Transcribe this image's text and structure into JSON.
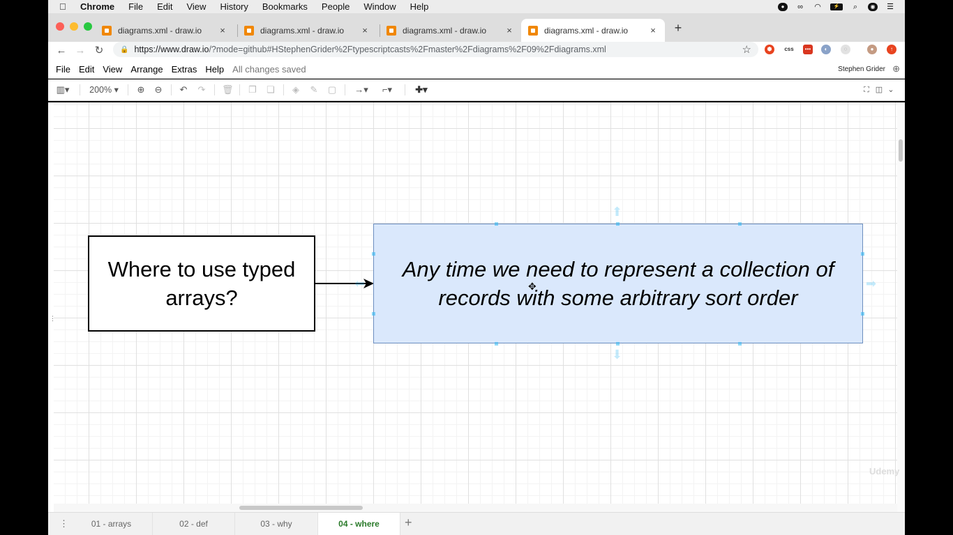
{
  "menubar": {
    "app": "Chrome",
    "items": [
      "File",
      "Edit",
      "View",
      "History",
      "Bookmarks",
      "People",
      "Window",
      "Help"
    ]
  },
  "tabs": [
    {
      "title": "diagrams.xml - draw.io",
      "close": "×"
    },
    {
      "title": "diagrams.xml - draw.io",
      "close": "×"
    },
    {
      "title": "diagrams.xml - draw.io",
      "close": "×"
    },
    {
      "title": "diagrams.xml - draw.io",
      "close": "×"
    }
  ],
  "new_tab": "+",
  "address": {
    "host": "https://www.draw.io",
    "rest": "/?mode=github#HStephenGrider%2Ftypescriptcasts%2Fmaster%2Fdiagrams%2F09%2Fdiagrams.xml"
  },
  "drawio_menu": {
    "items": [
      "File",
      "Edit",
      "View",
      "Arrange",
      "Extras",
      "Help"
    ],
    "status": "All changes saved",
    "user": "Stephen Grider"
  },
  "toolbar": {
    "zoom": "200%"
  },
  "diagram": {
    "left_box_text": "Where to use typed arrays?",
    "right_box_text": "Any time we need to represent a collection of records with some arbitrary sort order",
    "right_box_fill": "#dae8fc",
    "right_box_stroke": "#6c8ebf"
  },
  "watermark": "Udemy",
  "page_tabs": [
    "01 - arrays",
    "02 - def",
    "03 - why",
    "04 - where"
  ],
  "active_page_tab": "04 - where",
  "add_page": "+"
}
